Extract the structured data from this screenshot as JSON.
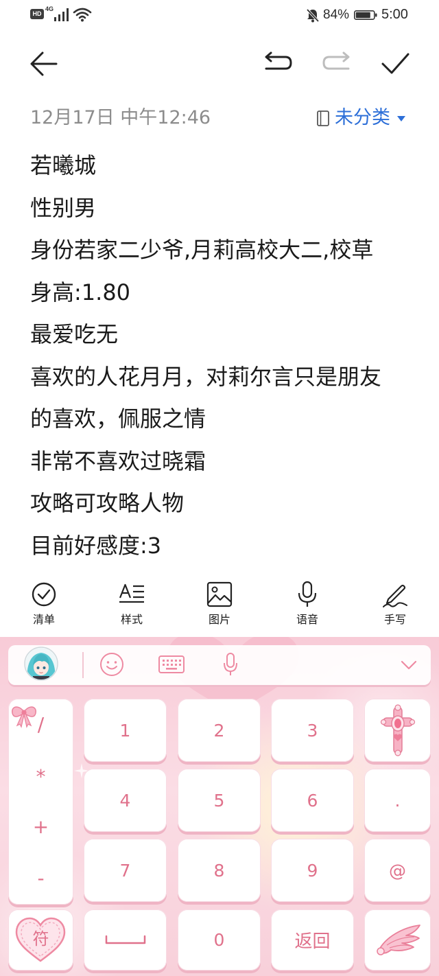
{
  "status_bar": {
    "hd_badge": "HD",
    "network_type": "4G",
    "battery_percent": "84%",
    "battery_level": 0.84,
    "time": "5:00",
    "icons": [
      "signal-icon",
      "wifi-icon",
      "notifications-muted-icon",
      "battery-icon"
    ]
  },
  "toolbar": {
    "icons": [
      "arrow-left-icon",
      "undo-icon",
      "redo-icon",
      "checkmark-icon"
    ],
    "redo_enabled": false
  },
  "note": {
    "date": "12月17日 中午12:46",
    "category": "未分类",
    "category_icon": "notebook-icon",
    "lines": [
      "若曦城",
      "性别男",
      "身份若家二少爷,月莉高校大二,校草",
      "身高:1.80",
      "最爱吃无",
      "喜欢的人花月月，对莉尔言只是朋友",
      "的喜欢，佩服之情",
      "非常不喜欢过晓霜",
      "攻略可攻略人物",
      "目前好感度:3"
    ]
  },
  "tools": [
    {
      "label": "清单",
      "icon": "checklist-icon"
    },
    {
      "label": "样式",
      "icon": "text-style-icon"
    },
    {
      "label": "图片",
      "icon": "image-icon"
    },
    {
      "label": "语音",
      "icon": "microphone-icon"
    },
    {
      "label": "手写",
      "icon": "handwriting-pen-icon"
    }
  ],
  "keyboard": {
    "toolbar_icons": [
      "avatar",
      "emoji-icon",
      "keyboard-icon",
      "microphone-icon",
      "chevron-down-icon"
    ],
    "symbols": [
      "/",
      "*",
      "+",
      "-"
    ],
    "digits": [
      [
        "1",
        "2",
        "3"
      ],
      [
        "4",
        "5",
        "6"
      ],
      [
        "7",
        "8",
        "9"
      ]
    ],
    "side_keys": [
      ".",
      "@"
    ],
    "symbol_key": "符",
    "zero": "0",
    "back_key": "返回",
    "decoration_icons": [
      "bow-icon",
      "cross-icon",
      "heart-icon",
      "wing-icon",
      "space-bar-icon"
    ]
  },
  "colors": {
    "accent_blue": "#2d6fd8",
    "date_gray": "#8c8c8c",
    "redo_disabled_gray": "#bdbdbd",
    "keyboard_pink": "#f8cfd9",
    "key_text_pink": "#e0718b"
  }
}
